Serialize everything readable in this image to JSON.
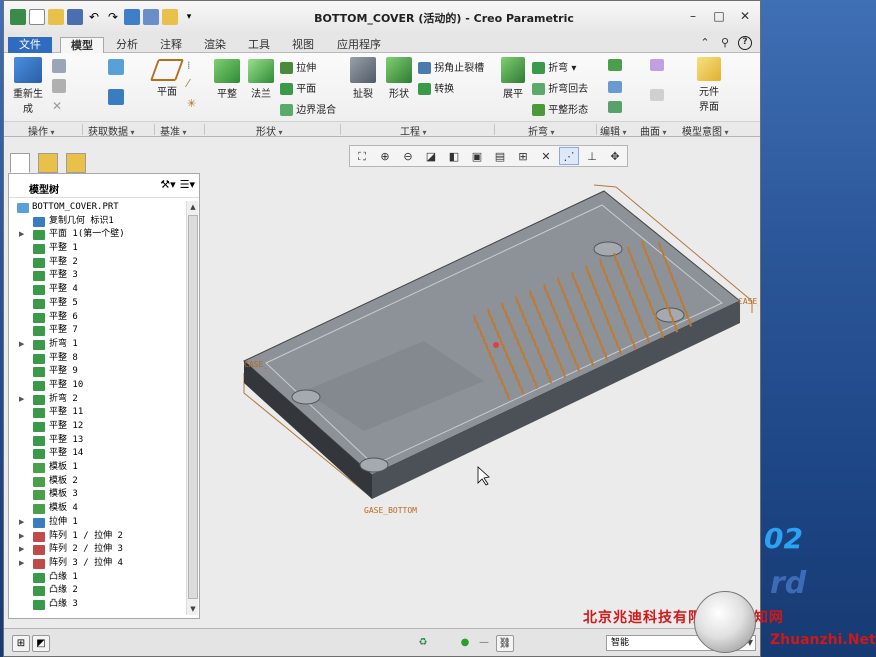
{
  "window": {
    "title": "BOTTOM_COVER (活动的) - Creo Parametric",
    "controls": [
      "–",
      "□",
      "✕"
    ]
  },
  "tabs": [
    {
      "label": "文件",
      "type": "file"
    },
    {
      "label": "模型",
      "type": "active"
    },
    {
      "label": "分析"
    },
    {
      "label": "注释"
    },
    {
      "label": "渲染"
    },
    {
      "label": "工具"
    },
    {
      "label": "视图"
    },
    {
      "label": "应用程序"
    }
  ],
  "ribbon": {
    "regenerate": "重新生",
    "regenerate2": "成",
    "plane": "平面",
    "flat1": "平整",
    "flange": "法兰",
    "extrude": "拉伸",
    "flat2": "平面",
    "blend": "边界混合",
    "rip": "扯裂",
    "form": "形状",
    "corner_relief": "拐角止裂槽",
    "convert": "转换",
    "unbend": "展平",
    "bend": "折弯",
    "bend_back": "折弯回去",
    "flat_pattern": "平整形态",
    "component": "元件",
    "component2": "界面",
    "groups": [
      "操作",
      "获取数据",
      "基准",
      "形状",
      "工程",
      "折弯",
      "编辑",
      "曲面",
      "模型意图"
    ]
  },
  "tree": {
    "title": "模型树",
    "items": [
      {
        "label": "BOTTOM_COVER.PRT",
        "level": 0,
        "icon": "part",
        "exp": ""
      },
      {
        "label": "复制几何 标识1",
        "level": 1,
        "icon": "copygeom",
        "exp": ""
      },
      {
        "label": "平面 1(第一个壁)",
        "level": 1,
        "icon": "wall",
        "exp": "▶"
      },
      {
        "label": "平整 1",
        "level": 1,
        "icon": "flat",
        "exp": ""
      },
      {
        "label": "平整 2",
        "level": 1,
        "icon": "flat",
        "exp": ""
      },
      {
        "label": "平整 3",
        "level": 1,
        "icon": "flat",
        "exp": ""
      },
      {
        "label": "平整 4",
        "level": 1,
        "icon": "flat",
        "exp": ""
      },
      {
        "label": "平整 5",
        "level": 1,
        "icon": "flat",
        "exp": ""
      },
      {
        "label": "平整 6",
        "level": 1,
        "icon": "flat",
        "exp": ""
      },
      {
        "label": "平整 7",
        "level": 1,
        "icon": "flat",
        "exp": ""
      },
      {
        "label": "折弯 1",
        "level": 1,
        "icon": "bend",
        "exp": "▶"
      },
      {
        "label": "平整 8",
        "level": 1,
        "icon": "flat",
        "exp": ""
      },
      {
        "label": "平整 9",
        "level": 1,
        "icon": "flat",
        "exp": ""
      },
      {
        "label": "平整 10",
        "level": 1,
        "icon": "flat",
        "exp": ""
      },
      {
        "label": "折弯 2",
        "level": 1,
        "icon": "bend",
        "exp": "▶"
      },
      {
        "label": "平整 11",
        "level": 1,
        "icon": "flat",
        "exp": ""
      },
      {
        "label": "平整 12",
        "level": 1,
        "icon": "flat",
        "exp": ""
      },
      {
        "label": "平整 13",
        "level": 1,
        "icon": "flat",
        "exp": ""
      },
      {
        "label": "平整 14",
        "level": 1,
        "icon": "flat",
        "exp": ""
      },
      {
        "label": "模板 1",
        "level": 1,
        "icon": "form",
        "exp": ""
      },
      {
        "label": "模板 2",
        "level": 1,
        "icon": "form",
        "exp": ""
      },
      {
        "label": "模板 3",
        "level": 1,
        "icon": "form",
        "exp": ""
      },
      {
        "label": "模板 4",
        "level": 1,
        "icon": "form",
        "exp": ""
      },
      {
        "label": "拉伸 1",
        "level": 1,
        "icon": "extrude",
        "exp": "▶"
      },
      {
        "label": "阵列 1 / 拉伸 2",
        "level": 1,
        "icon": "pattern",
        "exp": "▶"
      },
      {
        "label": "阵列 2 / 拉伸 3",
        "level": 1,
        "icon": "pattern",
        "exp": "▶"
      },
      {
        "label": "阵列 3 / 拉伸 4",
        "level": 1,
        "icon": "pattern",
        "exp": "▶"
      },
      {
        "label": "凸缘 1",
        "level": 1,
        "icon": "flange",
        "exp": ""
      },
      {
        "label": "凸缘 2",
        "level": 1,
        "icon": "flange",
        "exp": ""
      },
      {
        "label": "凸缘 3",
        "level": 1,
        "icon": "flange",
        "exp": ""
      }
    ]
  },
  "graphics": {
    "datum_labels": [
      "CASE_",
      "CASE_",
      "GASE_BOTTOM"
    ]
  },
  "status": {
    "filter_value": "智能"
  },
  "watermark": {
    "cn": "北京兆迪科技有限公司  专知网",
    "en": "Zhuanzhi.Net",
    "desktop_num": "02",
    "desktop_rd": "rd"
  },
  "colors": {
    "file_tab": "#2f6cc0",
    "cover_surface": "#8a8f96",
    "hole_grid": "#c07a30",
    "datum": "#b86a20"
  }
}
